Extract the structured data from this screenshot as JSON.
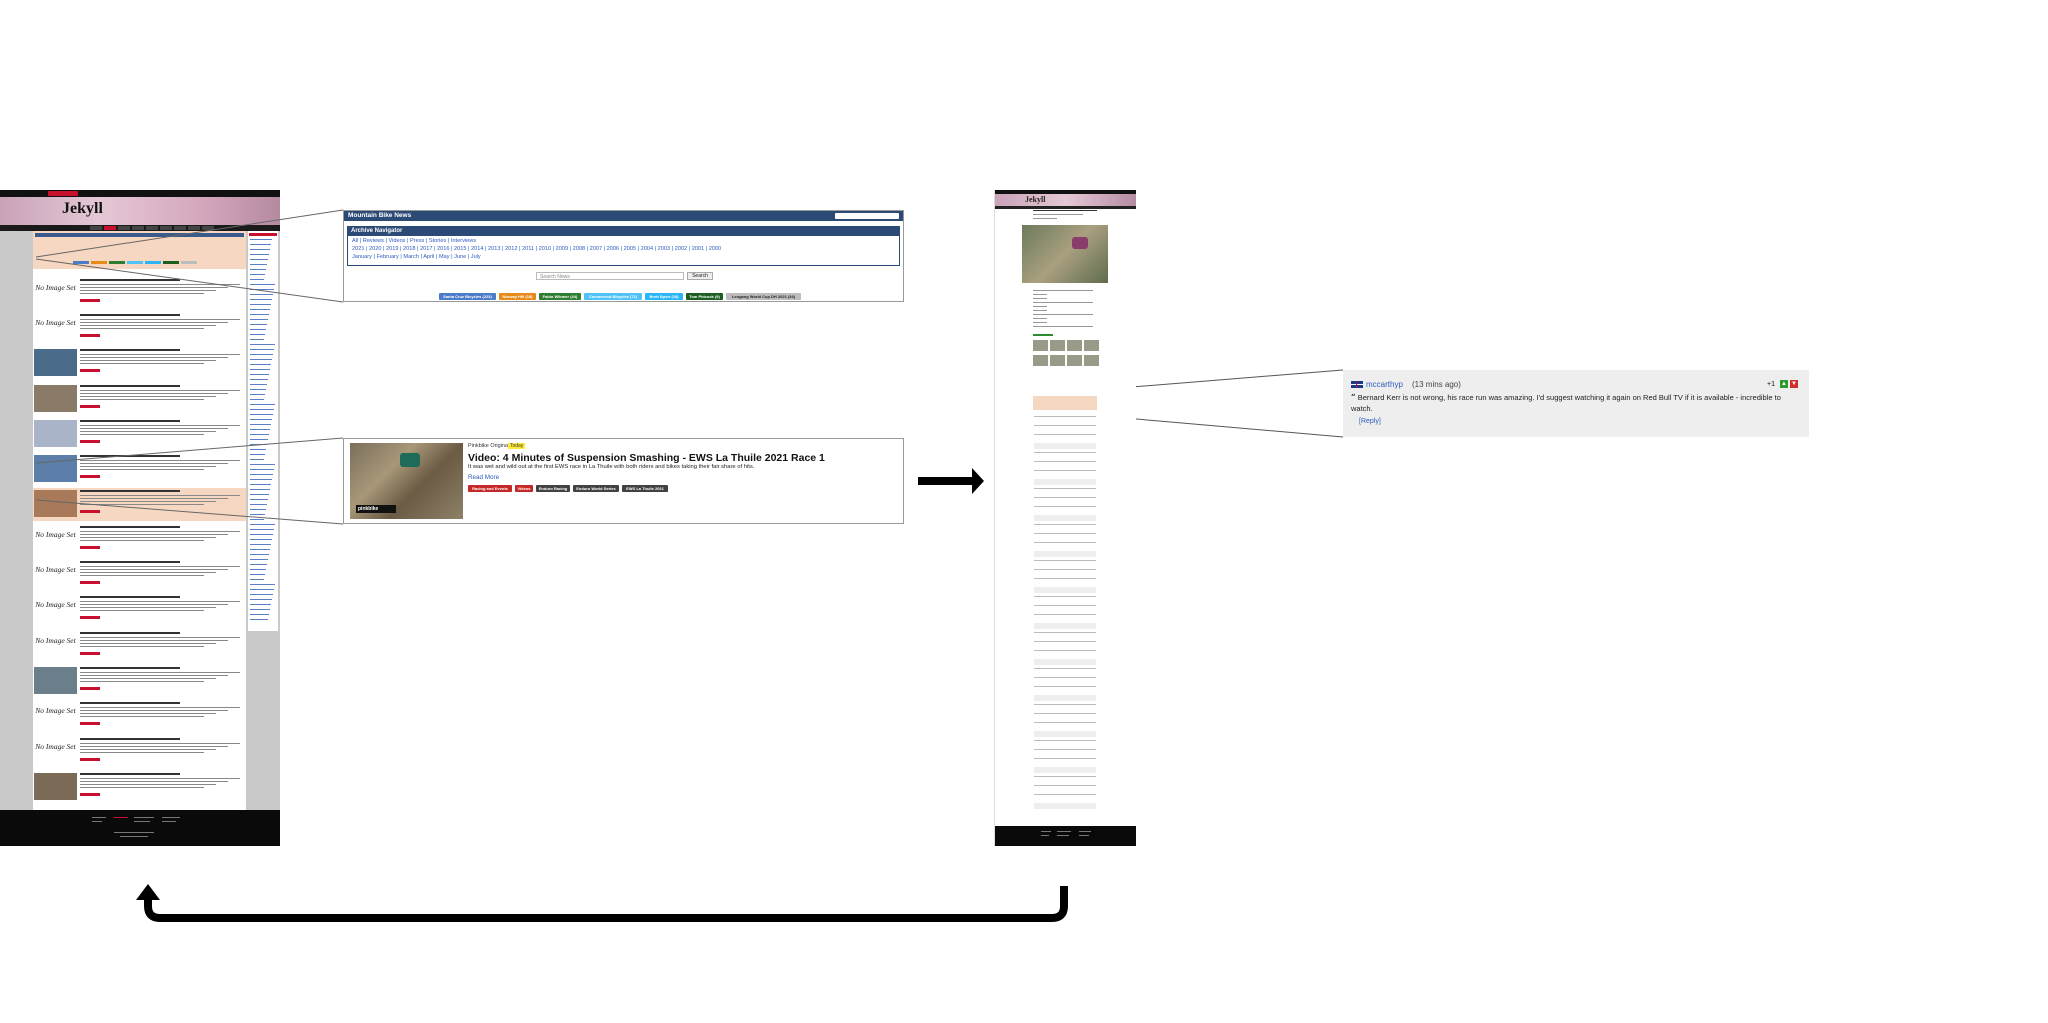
{
  "left_page": {
    "site_logo": "JEKYLL",
    "site_title": "Jekyll",
    "no_image_label": "No Image Set"
  },
  "navigator": {
    "header_title": "Mountain Bike News",
    "box_title": "Archive Navigator",
    "categories": "All | Reviews | Videos | Press | Stories | Interviews",
    "years": "2021 | 2020 | 2019 | 2018 | 2017 | 2016 | 2015 | 2014 | 2013 | 2012 | 2011 | 2010 | 2009 | 2008 | 2007 | 2006 | 2005 | 2004 | 2003 | 2002 | 2001 | 2000",
    "months": "January | February | March | April | May | June | July",
    "search_placeholder": "Search News",
    "search_button": "Search",
    "tags": [
      {
        "label": "Santa Cruz Bicycles (223)",
        "color": "#4a7cc9"
      },
      {
        "label": "Norway Hill (18)",
        "color": "#e88a1a"
      },
      {
        "label": "Fabio Wibmer (44)",
        "color": "#2e7d32"
      },
      {
        "label": "Commencal Bicycles (71)",
        "color": "#4fc3f7"
      },
      {
        "label": "Brett Sport (18)",
        "color": "#29b6f6"
      },
      {
        "label": "Tom Pidcock (9)",
        "color": "#1b5e20"
      },
      {
        "label": "Leogang World Cup DH 2021 (34)",
        "color": "#bdbdbd"
      }
    ]
  },
  "article": {
    "category": "Pinkbike Originals",
    "badge": "Today",
    "headline": "Video: 4 Minutes of Suspension Smashing - EWS La Thuile 2021 Race 1",
    "description": "It was wet and wild out at the first EWS race in La Thuile with both riders and bikes taking their fair share of hits.",
    "read_more": "Read More",
    "image_logo": "pinkbike",
    "tags": [
      {
        "label": "Racing and Events",
        "color": "#c62828"
      },
      {
        "label": "Videos",
        "color": "#c62828"
      },
      {
        "label": "Enduro Racing",
        "color": "#424242"
      },
      {
        "label": "Enduro World Series",
        "color": "#424242"
      },
      {
        "label": "EWS La Thuile 2021",
        "color": "#424242"
      }
    ]
  },
  "comment": {
    "username": "mccarthyp",
    "time": "(13 mins ago)",
    "score": "+1",
    "up_icon": "thumb-up-icon",
    "down_icon": "thumb-down-icon",
    "quote_mark": "“",
    "text": "Bernard Kerr is not wrong, his race run was amazing. I'd suggest watching it again on Red Bull TV if it is available - incredible to watch.",
    "reply": "[Reply]"
  },
  "right_page": {
    "site_title": "Jekyll"
  },
  "colors": {
    "accent": "#c8102e",
    "navy": "#2c4a76",
    "link": "#2d5bbf",
    "highlight": "#f6d7c2"
  }
}
